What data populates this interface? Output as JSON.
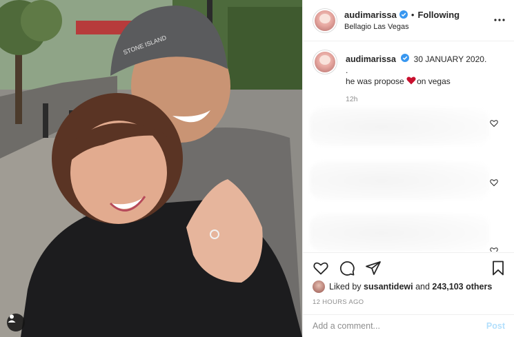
{
  "post": {
    "username": "audimarissa",
    "verified": true,
    "follow_status": "Following",
    "location": "Bellagio Las Vegas",
    "more_icon": "more-horizontal-icon"
  },
  "caption": {
    "username": "audimarissa",
    "date_text": "30 JANUARY 2020.",
    "dot_line": ".",
    "text_before": "he was propose ",
    "text_after": "on vegas",
    "time": "12h"
  },
  "photo": {
    "beanie_text": "STONE ISLAND"
  },
  "actions": {
    "like_icon": "heart-icon",
    "comment_icon": "comment-icon",
    "share_icon": "share-icon",
    "save_icon": "bookmark-icon"
  },
  "likes": {
    "prefix": "Liked by ",
    "user": "susantidewi",
    "middle": " and ",
    "count": "243,103 others"
  },
  "timestamp": "12 HOURS AGO",
  "comment_box": {
    "placeholder": "Add a comment...",
    "post_label": "Post"
  },
  "colors": {
    "verified_blue": "#3897f0",
    "heart_red": "#c8102e",
    "post_disabled": "#b2dffc",
    "muted_text": "#8e8e8e"
  }
}
